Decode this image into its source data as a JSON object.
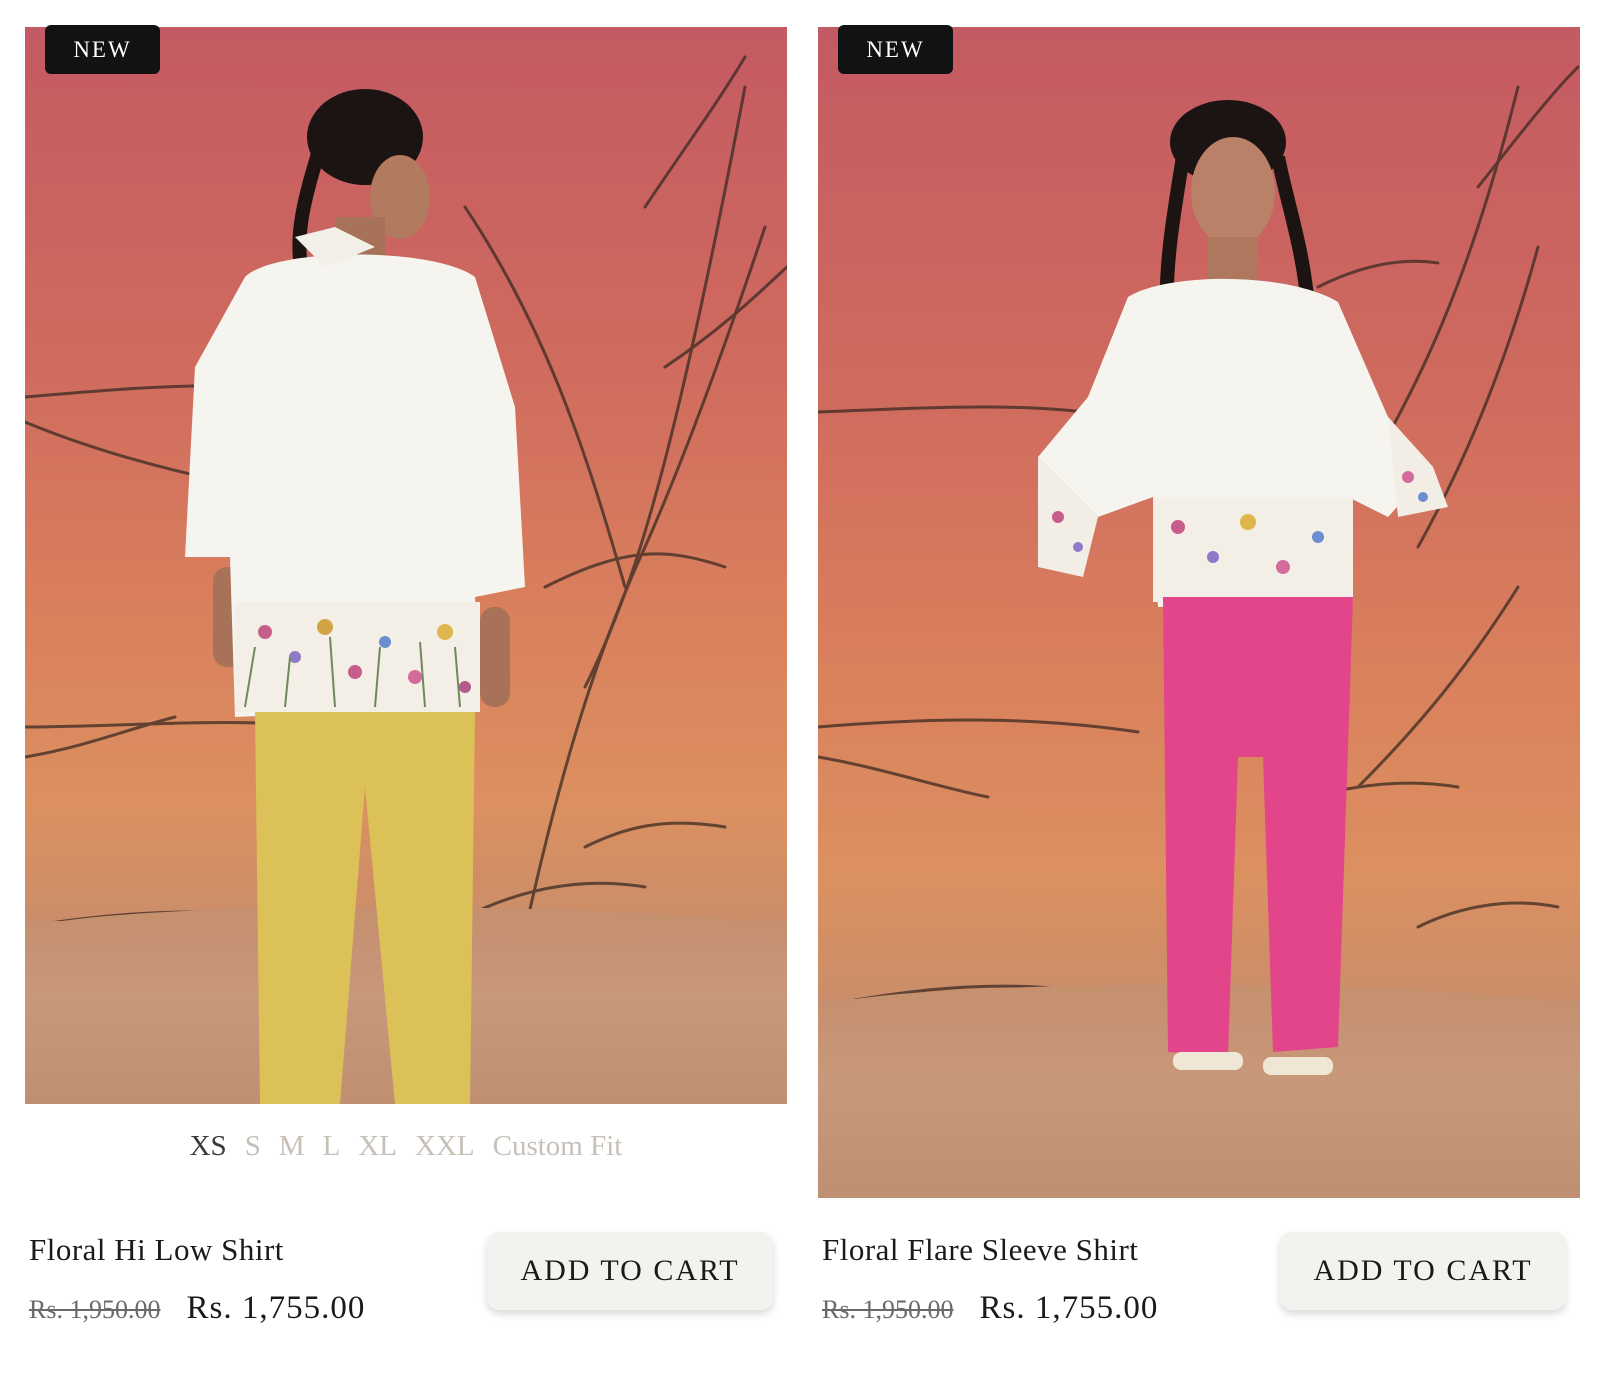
{
  "products": [
    {
      "badge": "NEW",
      "image_alt": "Model in white shirt with floral hem and yellow trousers, back view",
      "sizes": [
        "XS",
        "S",
        "M",
        "L",
        "XL",
        "XXL",
        "Custom Fit"
      ],
      "active_size": "XS",
      "title": "Floral Hi Low Shirt",
      "compare_price": "Rs. 1,950.00",
      "price": "Rs. 1,755.00",
      "cart_label": "ADD TO CART"
    },
    {
      "badge": "NEW",
      "image_alt": "Model in white flare sleeve shirt with floral hem and pink trousers",
      "title": "Floral Flare Sleeve Shirt",
      "compare_price": "Rs. 1,950.00",
      "price": "Rs. 1,755.00",
      "cart_label": "ADD TO CART"
    }
  ],
  "colors": {
    "backdrop_top": "#c45a63",
    "backdrop_bottom": "#dc9060",
    "sand": "#c6916f",
    "badge_bg": "#121212",
    "button_bg": "#f4f2ef",
    "size_active": "#3a3a3a",
    "size_inactive": "#c7c0b8"
  }
}
